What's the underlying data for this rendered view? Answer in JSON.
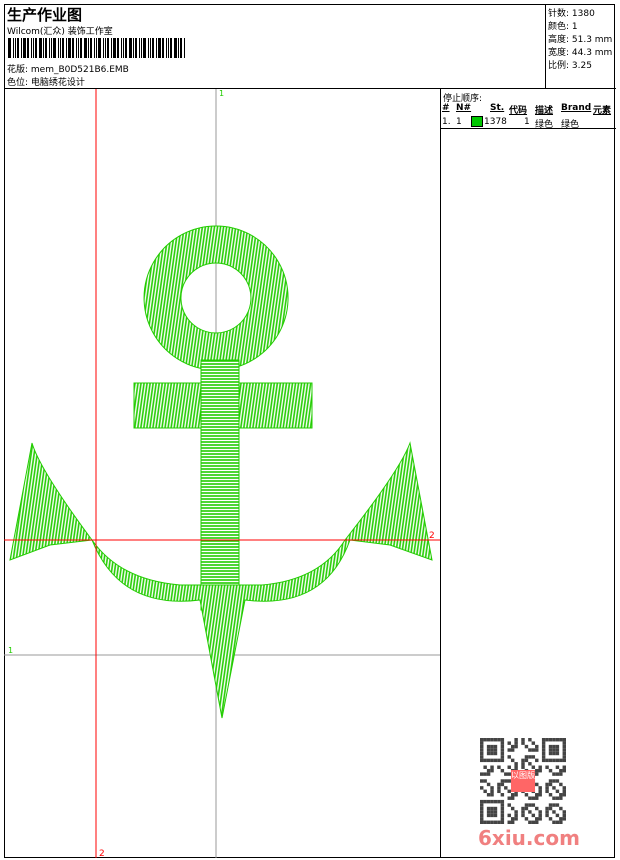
{
  "header": {
    "title": "生产作业图",
    "company": "Wilcom(汇众) 装饰工作室",
    "design_label": "花版: mem_B0D521B6.EMB",
    "color_label": "色位: 电脑绣花设计"
  },
  "info": {
    "stitches": "针数: 1380",
    "colors": "颜色: 1",
    "height": "高度: 51.3 mm",
    "width": "宽度: 44.3 mm",
    "scale": "比例: 3.25"
  },
  "stop_sequence": {
    "title": "停止顺序:",
    "columns": [
      "#",
      "N#",
      "St.",
      "代码",
      "描述",
      "Brand",
      "元素"
    ],
    "rows": [
      {
        "index": "1.",
        "n": "1",
        "color": "#00c800",
        "stitches": "1378",
        "code": "1",
        "description": "绿色",
        "brand": "绿色"
      }
    ]
  },
  "guides": {
    "green_top": "1",
    "green_left": "1",
    "red_bottom": "2",
    "red_right": "2"
  },
  "colors": {
    "thread": "#22cc00",
    "guide_red": "#ff0000",
    "guide_gray": "#999999"
  },
  "watermark": {
    "text": "6xiu.com",
    "seal": "以图版"
  }
}
